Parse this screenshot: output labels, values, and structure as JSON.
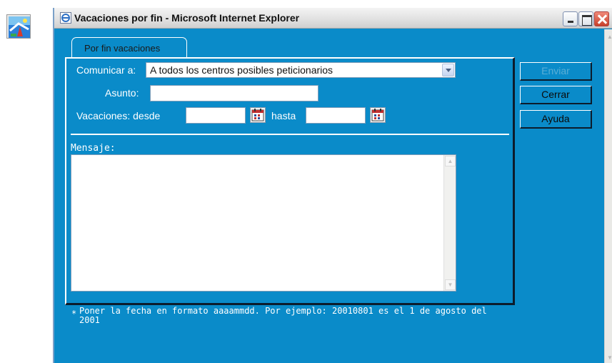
{
  "window": {
    "title": "Vacaciones por fin - Microsoft Internet Explorer"
  },
  "tab": {
    "label": "Por fin vacaciones"
  },
  "form": {
    "comunicar_label": "Comunicar a:",
    "comunicar_value": "A todos los centros posibles peticionarios",
    "asunto_label": "Asunto:",
    "asunto_value": "",
    "vacaciones_label": "Vacaciones: desde",
    "desde_value": "",
    "hasta_label": "hasta",
    "hasta_value": "",
    "mensaje_label": "Mensaje:",
    "mensaje_value": ""
  },
  "buttons": {
    "enviar": "Enviar",
    "cerrar": "Cerrar",
    "ayuda": "Ayuda"
  },
  "note": {
    "marker": "*",
    "text": "Poner la fecha en formato aaaammdd. Por ejemplo: 20010801 es el 1 de agosto del 2001"
  },
  "colors": {
    "window_bg": "#0a8bc9",
    "panel_border_light": "#ffffff",
    "panel_border_dark": "#0c1c2c",
    "disabled_text": "#5aaed6"
  },
  "icons": [
    "desktop-app-icon",
    "ie-icon",
    "minimize-icon",
    "maximize-icon",
    "close-icon",
    "chevron-down-icon",
    "calendar-icon",
    "scroll-up-icon",
    "scroll-down-icon"
  ]
}
